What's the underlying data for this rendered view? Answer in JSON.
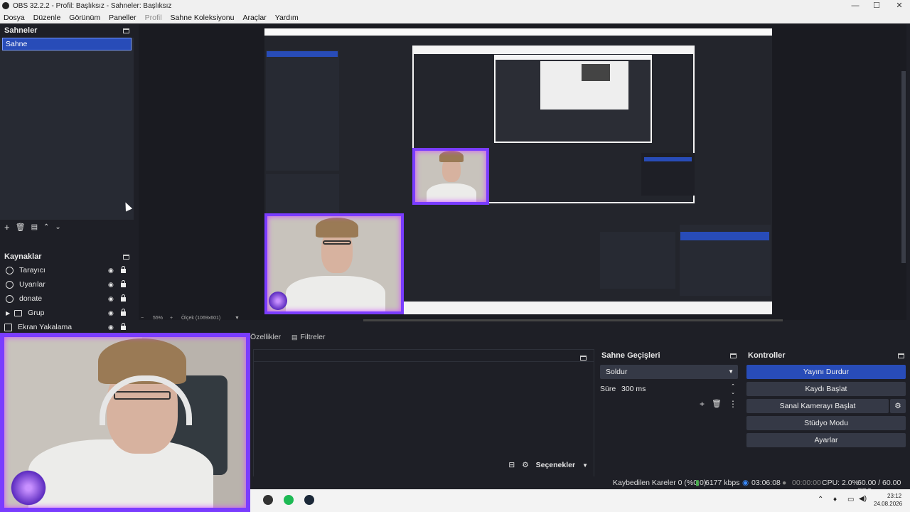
{
  "window": {
    "title": "OBS 32.2.2 - Profil: Başlıksız - Sahneler: Başlıksız"
  },
  "menu": [
    "Dosya",
    "Düzenle",
    "Görünüm",
    "Paneller",
    "Profil",
    "Sahne Koleksiyonu",
    "Araçlar",
    "Yardım"
  ],
  "scenes": {
    "title": "Sahneler",
    "items": [
      "Sahne"
    ]
  },
  "sources": {
    "title": "Kaynaklar",
    "items": [
      {
        "label": "Tarayıcı",
        "icon": "globe-icon"
      },
      {
        "label": "Uyarılar",
        "icon": "globe-icon"
      },
      {
        "label": "donate",
        "icon": "globe-icon"
      },
      {
        "label": "Grup",
        "icon": "folder-icon"
      },
      {
        "label": "Ekran Yakalama",
        "icon": "monitor-icon"
      }
    ]
  },
  "preview": {
    "zoom": "55%",
    "canvas_label": "Ölçek (1069x601)"
  },
  "tabs": {
    "properties": "Özellikler",
    "filters": "Filtreler"
  },
  "mixer": {
    "options_label": "Seçenekler"
  },
  "transitions": {
    "title": "Sahne Geçişleri",
    "selected": "Soldur",
    "duration_label": "Süre",
    "duration_value": "300 ms"
  },
  "controls": {
    "title": "Kontroller",
    "stop_stream": "Yayını Durdur",
    "start_recording": "Kaydı Başlat",
    "start_virtualcam": "Sanal Kamerayı Başlat",
    "studio_mode": "Stüdyo Modu",
    "settings": "Ayarlar"
  },
  "status": {
    "dropped_frames": "Kaybedilen Kareler 0 (%0.0)",
    "bitrate": "6177 kbps",
    "stream_time": "03:06:08",
    "record_time": "00:00:00",
    "cpu": "CPU: 2.0%",
    "fps": "60.00 / 60.00 FPS"
  },
  "taskbar": {
    "time": "23:12",
    "date": "24.08.2026"
  },
  "colors": {
    "accent": "#284cb8",
    "panel": "#1e1f26",
    "neon": "#7a3cff"
  }
}
